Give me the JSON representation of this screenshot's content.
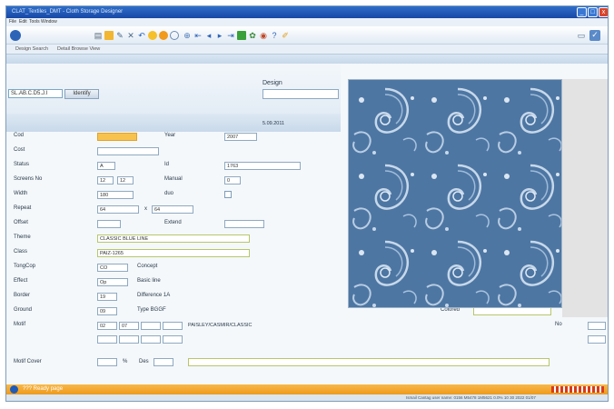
{
  "window": {
    "title": "CLAT_Textiles_DMT - Cloth Storage Designer",
    "controls": [
      "_",
      "□",
      "x"
    ]
  },
  "menu": [
    "File",
    "Edit",
    "Tools",
    "Window"
  ],
  "toolbar_icons": [
    "app-icon",
    "print-icon",
    "folder-icon",
    "tools-icon",
    "delete-icon",
    "undo-icon",
    "circle-yellow-icon",
    "circle-orange-icon",
    "circle-blue-icon",
    "add-icon",
    "first-icon",
    "prev-icon",
    "next-icon",
    "last-icon",
    "refresh-icon",
    "palette-icon",
    "eye-icon",
    "help-icon",
    "pen-icon",
    "minimize-doc-icon",
    "checklist-icon"
  ],
  "tabs": [
    "Design Search",
    "Detail Browse View"
  ],
  "search": {
    "query": "SL.AB.C.D5.J.I",
    "button": "Identify",
    "design_label": "Design",
    "design_value": ""
  },
  "date": "5.09.2011",
  "fields": {
    "cod_label": "Cod",
    "cod_value": "",
    "year_label": "Year",
    "year_value": "2007",
    "cost_label": "Cost",
    "cost_value": "",
    "status_label": "Status",
    "status_value": "A",
    "id_label": "Id",
    "id_value": "1763",
    "screens_label": "Screens No",
    "screens_a": "12",
    "screens_b": "12",
    "manual_label": "Manual",
    "manual_value": "0",
    "width_label": "Width",
    "width_value": "180",
    "duo_label": "duo",
    "repeat_label": "Repeat",
    "repeat_a": "64",
    "repeat_x": "x",
    "repeat_b": "64",
    "offset_label": "Offset",
    "offset_value": "",
    "extend_label": "Extend",
    "extend_value": "",
    "theme_label": "Theme",
    "theme_value": "CLASSIC BLUE LINE",
    "class_label": "Class",
    "class_value": "PAIZ-1265",
    "tonecode_label": "TongCop",
    "tonecode_value": "CO",
    "tonecode_desc": "Concept",
    "effect_label": "Effect",
    "effect_value": "Op",
    "effect_desc": "Basic line",
    "border_label": "Border",
    "border_value": "19",
    "border_desc": "Difference 1A",
    "ground_label": "Ground",
    "ground_value": "09",
    "ground_desc": "Type BGGF",
    "motif_label": "Motif",
    "motif_a": "02",
    "motif_b": "07",
    "motif_c": "",
    "motif_d": "",
    "motif_text": "PAISLEY/CASMIR/CLASSIC",
    "colored_label": "Colored",
    "colored_value": "",
    "no_label": "No",
    "no_value": "",
    "motif_cover_label": "Motif Cover",
    "percent": "%",
    "des_label": "Des"
  },
  "status": {
    "message": "??? Ready page",
    "bottom": "Ismail Cantag user name: 0156 M5478 1M5621 0.0% 10 30 2022 01/07"
  },
  "colors": {
    "accent": "#1f5bb8",
    "status": "#f2a324",
    "highlight": "#f7c24d",
    "fabric": "#4d76a3"
  }
}
